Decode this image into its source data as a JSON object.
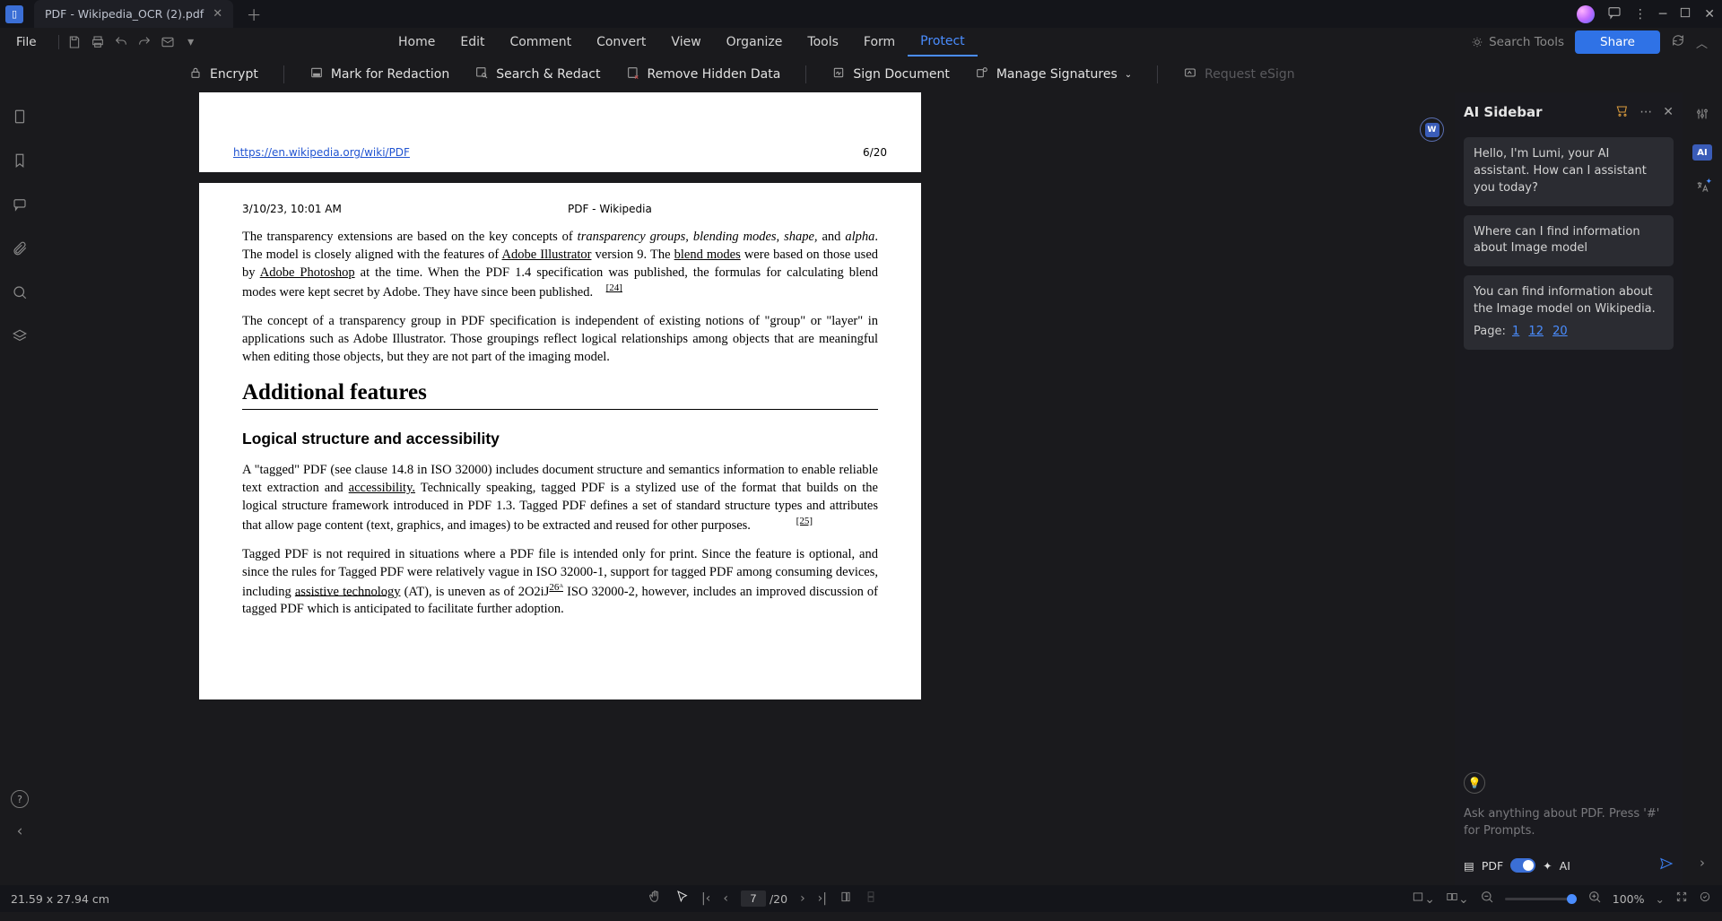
{
  "app": {
    "tab_title": "PDF - Wikipedia_OCR (2).pdf"
  },
  "quickbar": {
    "file_label": "File"
  },
  "nav": {
    "home": "Home",
    "edit": "Edit",
    "comment": "Comment",
    "convert": "Convert",
    "view": "View",
    "organize": "Organize",
    "tools": "Tools",
    "form": "Form",
    "protect": "Protect",
    "search": "Search Tools",
    "share": "Share"
  },
  "toolbar": {
    "encrypt": "Encrypt",
    "mark_redaction": "Mark for Redaction",
    "search_redact": "Search & Redact",
    "remove_hidden": "Remove Hidden Data",
    "sign_document": "Sign Document",
    "manage_signatures": "Manage Signatures",
    "request_esign": "Request eSign"
  },
  "doc": {
    "url": "https://en.wikipedia.org/wiki/PDF",
    "page_counter_prev": "6/20",
    "timestamp": "3/10/23, 10:01 AM",
    "header_title": "PDF - Wikipedia",
    "h_additional": "Additional features",
    "h_logical": "Logical structure and accessibility"
  },
  "sidebar": {
    "title": "AI Sidebar",
    "msg_greeting": "Hello, I'm Lumi, your AI assistant. How can I assistant you today?",
    "msg_user": "Where can I find information about Image model",
    "msg_answer": "You can find information about the Image model on Wikipedia.",
    "pages_label": "Page:",
    "page_links": [
      "1",
      "12",
      "20"
    ],
    "input_placeholder": "Ask anything about PDF. Press '#' for Prompts.",
    "pdf_label": "PDF",
    "ai_label": "AI"
  },
  "status": {
    "dimensions": "21.59 x 27.94 cm",
    "current_page": "7",
    "total_pages": "/20",
    "zoom": "100%"
  },
  "colors": {
    "accent": "#4a8dff",
    "bg": "#1a1a1d"
  }
}
